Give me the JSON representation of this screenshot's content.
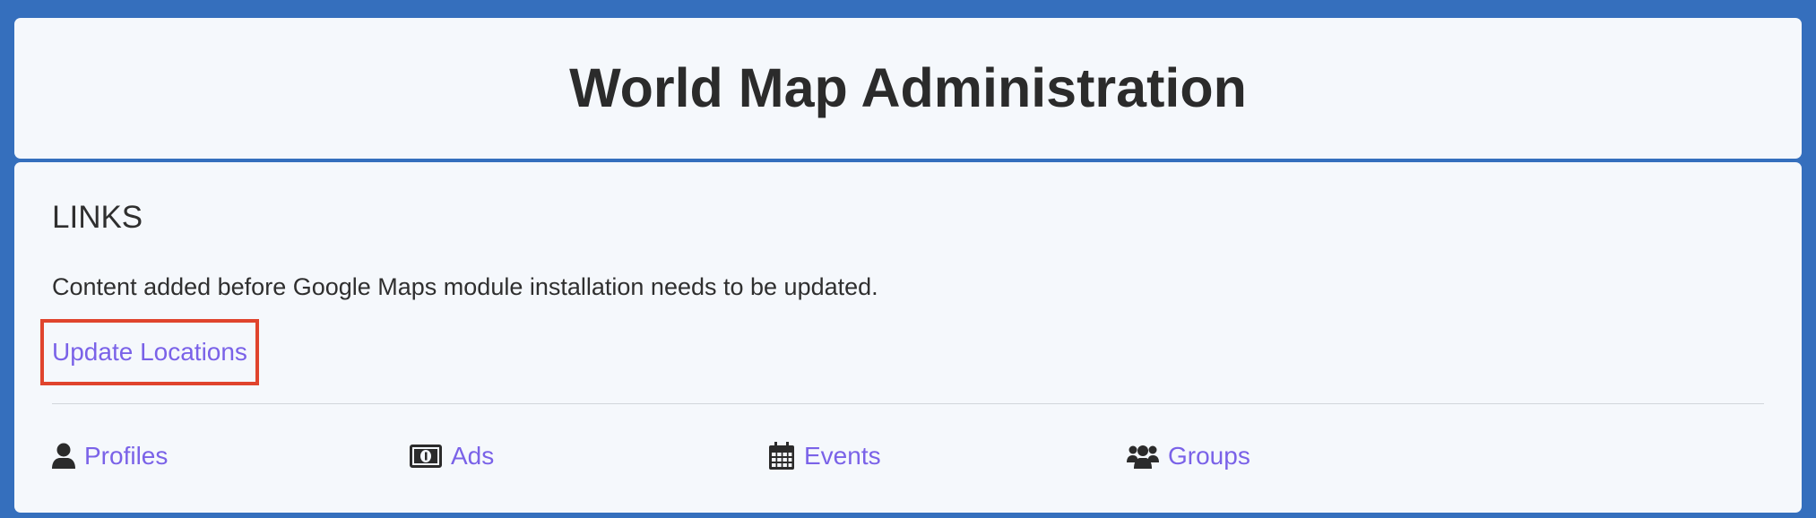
{
  "header": {
    "title": "World Map Administration"
  },
  "links_section": {
    "heading": "LINKS",
    "notice": "Content added before Google Maps module installation needs to be updated.",
    "update_link": "Update Locations"
  },
  "nav": [
    {
      "label": "Profiles",
      "icon": "user-icon"
    },
    {
      "label": "Ads",
      "icon": "money-bill-icon"
    },
    {
      "label": "Events",
      "icon": "calendar-icon"
    },
    {
      "label": "Groups",
      "icon": "users-icon"
    }
  ],
  "colors": {
    "background": "#356fbd",
    "panel": "#f5f8fc",
    "link": "#7a62e8",
    "highlight": "#e0442d",
    "text": "#2f2f2f"
  }
}
